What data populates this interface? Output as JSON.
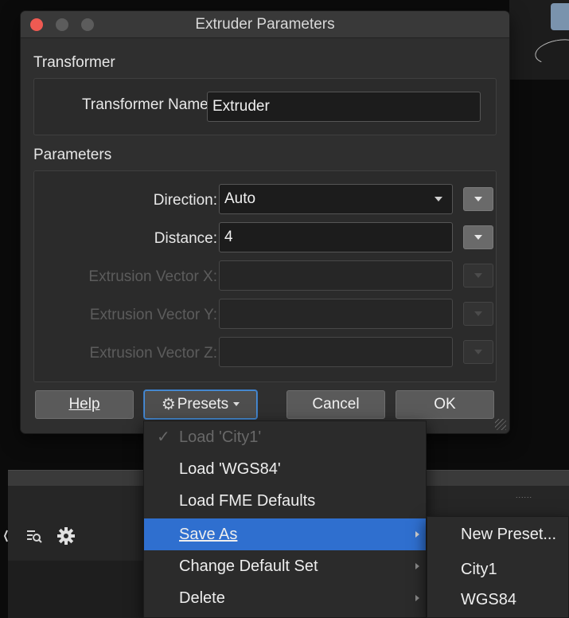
{
  "dialog": {
    "title": "Extruder Parameters",
    "transformer_section": "Transformer",
    "transformer_name_label": "Transformer Name:",
    "transformer_name_value": "Extruder",
    "parameters_section": "Parameters",
    "params": [
      {
        "label": "Direction:",
        "value": "Auto",
        "enabled": true,
        "type": "select"
      },
      {
        "label": "Distance:",
        "value": "4",
        "enabled": true,
        "type": "text"
      },
      {
        "label": "Extrusion Vector X:",
        "value": "",
        "enabled": false,
        "type": "text"
      },
      {
        "label": "Extrusion Vector Y:",
        "value": "",
        "enabled": false,
        "type": "text"
      },
      {
        "label": "Extrusion Vector Z:",
        "value": "",
        "enabled": false,
        "type": "text"
      }
    ],
    "buttons": {
      "help": "Help",
      "presets": "Presets",
      "cancel": "Cancel",
      "ok": "OK"
    }
  },
  "presets_menu": {
    "check_mark": "✓",
    "items": [
      {
        "label": "Load 'City1'",
        "checked": true,
        "enabled": false
      },
      {
        "label": "Load 'WGS84'",
        "enabled": true
      },
      {
        "label": "Load FME Defaults",
        "enabled": true
      },
      {
        "label": "Save As",
        "enabled": true,
        "submenu": true,
        "highlighted": true
      },
      {
        "label": "Change Default Set",
        "enabled": true,
        "submenu": true
      },
      {
        "label": "Delete",
        "enabled": true,
        "submenu": true
      }
    ]
  },
  "save_as_submenu": {
    "items": [
      "New Preset...",
      "City1",
      "WGS84"
    ]
  },
  "background": {
    "grip_text": "......"
  },
  "colors": {
    "accent": "#2f6fcf",
    "close_button": "#ee5a52",
    "dialog_bg": "#2f2f2f"
  }
}
